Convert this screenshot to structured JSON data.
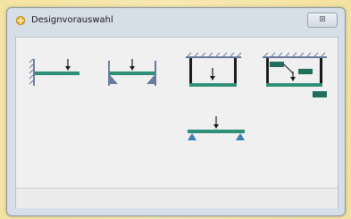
{
  "window": {
    "title": "Designvorauswahl",
    "close_label": "⊠"
  },
  "designs": [
    {
      "name": "cantilever"
    },
    {
      "name": "propped-beam"
    },
    {
      "name": "portal-frame"
    },
    {
      "name": "frame-with-labels"
    },
    {
      "name": "simply-supported-beam"
    }
  ],
  "colors": {
    "beam": "#2f8f77",
    "support": "#6a7a9c",
    "load": "#1a1a1a",
    "label": "#1f6f5c"
  }
}
